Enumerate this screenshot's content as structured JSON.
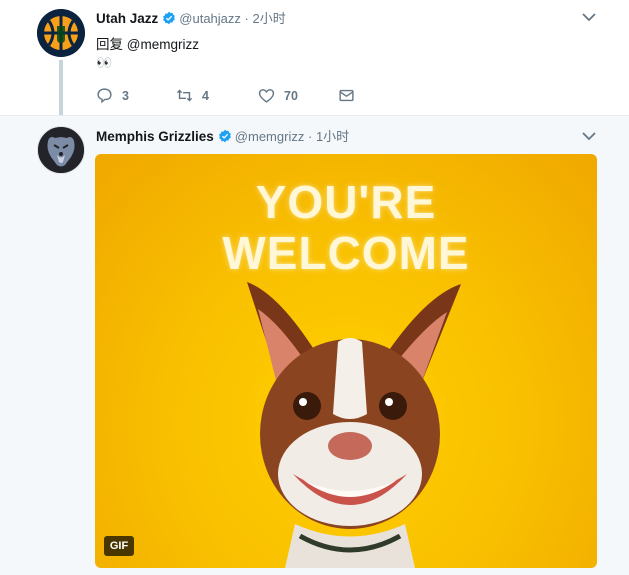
{
  "tweets": [
    {
      "name": "Utah Jazz",
      "handle": "@utahjazz",
      "separator": "·",
      "time": "2小时",
      "reply_prefix": "回复",
      "reply_mention": "@memgrizz",
      "text": "👀",
      "actions": {
        "reply_count": "3",
        "retweet_count": "4",
        "like_count": "70"
      },
      "avatar_icon": "utah-jazz-logo-icon"
    },
    {
      "name": "Memphis Grizzlies",
      "handle": "@memgrizz",
      "separator": "·",
      "time": "1小时",
      "media": {
        "type": "gif",
        "caption_line1": "YOU'RE",
        "caption_line2": "WELCOME",
        "badge": "GIF"
      },
      "avatar_icon": "memphis-grizzlies-logo-icon"
    }
  ],
  "colors": {
    "verified": "#1da1f2",
    "muted": "#657786",
    "thread_bg": "#f5f8fa",
    "gif_bg": "#f9c100"
  }
}
